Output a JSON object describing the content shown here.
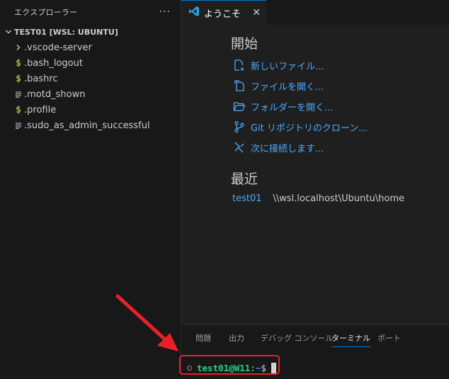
{
  "sidebar": {
    "title": "エクスプローラー",
    "more_label": "···",
    "workspace": "TEST01 [WSL: UBUNTU]",
    "items": [
      {
        "label": ".vscode-server",
        "icon": "chevron-right-icon"
      },
      {
        "label": ".bash_logout",
        "icon": "dollar-icon"
      },
      {
        "label": ".bashrc",
        "icon": "dollar-icon"
      },
      {
        "label": ".motd_shown",
        "icon": "lines-icon"
      },
      {
        "label": ".profile",
        "icon": "dollar-icon"
      },
      {
        "label": ".sudo_as_admin_successful",
        "icon": "lines-icon"
      }
    ]
  },
  "editor": {
    "tab_label": "ようこそ",
    "close_glyph": "✕"
  },
  "welcome": {
    "start_title": "開始",
    "start_items": [
      {
        "label": "新しいファイル...",
        "icon": "new-file-icon"
      },
      {
        "label": "ファイルを開く...",
        "icon": "open-file-icon"
      },
      {
        "label": "フォルダーを開く...",
        "icon": "open-folder-icon"
      },
      {
        "label": "Git リポジトリのクローン...",
        "icon": "git-branch-icon"
      },
      {
        "label": "次に接続します...",
        "icon": "remote-icon"
      }
    ],
    "recent_title": "最近",
    "recent": [
      {
        "name": "test01",
        "path": "\\\\wsl.localhost\\Ubuntu\\home"
      }
    ]
  },
  "panel": {
    "tabs": [
      "問題",
      "出力",
      "デバッグ コンソール",
      "ターミナル",
      "ポート"
    ],
    "active_tab": "ターミナル",
    "terminal": {
      "user_host": "test01@W11",
      "colon": ":",
      "path": "~",
      "dollar": "$"
    }
  },
  "colors": {
    "accent": "#0078d4",
    "link": "#4daafc",
    "annotation": "#e8202a",
    "terminal_green": "#23d18b",
    "dollar_green": "#8dc149"
  }
}
